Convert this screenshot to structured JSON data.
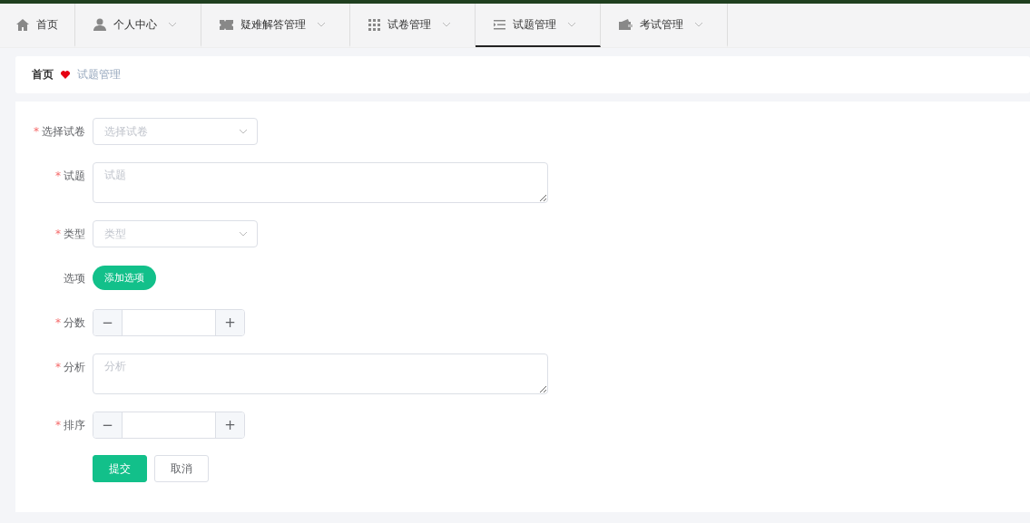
{
  "nav": {
    "tabs": [
      {
        "label": "首页",
        "dropdown": false,
        "selected": false
      },
      {
        "label": "个人中心",
        "dropdown": true,
        "selected": false
      },
      {
        "label": "疑难解答管理",
        "dropdown": true,
        "selected": false
      },
      {
        "label": "试卷管理",
        "dropdown": true,
        "selected": false
      },
      {
        "label": "试题管理",
        "dropdown": true,
        "selected": true
      },
      {
        "label": "考试管理",
        "dropdown": true,
        "selected": false
      }
    ]
  },
  "breadcrumb": {
    "home": "首页",
    "current": "试题管理"
  },
  "form": {
    "fields": [
      {
        "kind": "select",
        "required_mark": "*",
        "label": "选择试卷",
        "placeholder": "选择试卷"
      },
      {
        "kind": "textarea",
        "required_mark": "*",
        "label": "试题",
        "placeholder": "试题"
      },
      {
        "kind": "select",
        "required_mark": "*",
        "label": "类型",
        "placeholder": "类型"
      },
      {
        "kind": "button",
        "label": "选项",
        "button": "添加选项"
      },
      {
        "kind": "number",
        "required_mark": "*",
        "label": "分数",
        "minus": "−",
        "plus": "+"
      },
      {
        "kind": "textarea",
        "required_mark": "*",
        "label": "分析",
        "placeholder": "分析"
      },
      {
        "kind": "number",
        "required_mark": "*",
        "label": "排序",
        "minus": "−",
        "plus": "+"
      }
    ],
    "actions": [
      {
        "label": "提交",
        "primary": true
      },
      {
        "label": "取消",
        "primary": false
      }
    ]
  }
}
